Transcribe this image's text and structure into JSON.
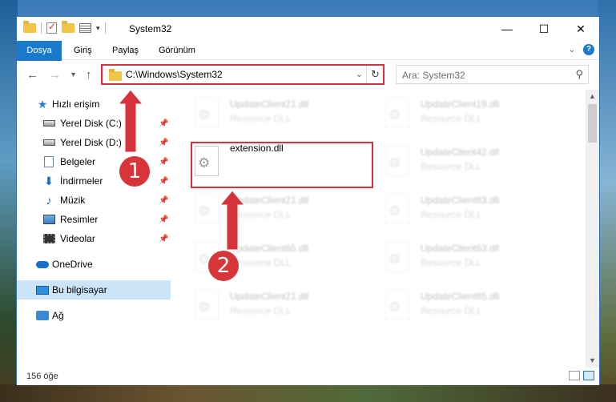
{
  "window": {
    "title": "System32",
    "controls": {
      "minimize": "—",
      "maximize": "☐",
      "close": "✕"
    }
  },
  "ribbon": {
    "tabs": [
      "Dosya",
      "Giriş",
      "Paylaş",
      "Görünüm"
    ]
  },
  "navigation": {
    "back": "←",
    "forward": "→",
    "recent": "▾",
    "up": "↑",
    "address": "C:\\Windows\\System32",
    "search_placeholder": "Ara: System32"
  },
  "sidebar": {
    "items": [
      {
        "label": "Hızlı erişim",
        "icon": "star-icon",
        "pinned": false
      },
      {
        "label": "Yerel Disk (C:)",
        "icon": "drive-icon",
        "pinned": true
      },
      {
        "label": "Yerel Disk (D:)",
        "icon": "drive-icon",
        "pinned": true
      },
      {
        "label": "Belgeler",
        "icon": "document-icon",
        "pinned": true
      },
      {
        "label": "İndirmeler",
        "icon": "download-icon",
        "pinned": true
      },
      {
        "label": "Müzik",
        "icon": "music-icon",
        "pinned": true
      },
      {
        "label": "Resimler",
        "icon": "pictures-icon",
        "pinned": true
      },
      {
        "label": "Videolar",
        "icon": "videos-icon",
        "pinned": true
      },
      {
        "label": "OneDrive",
        "icon": "cloud-icon",
        "pinned": false
      },
      {
        "label": "Bu bilgisayar",
        "icon": "computer-icon",
        "pinned": false,
        "selected": true
      },
      {
        "label": "Ağ",
        "icon": "network-icon",
        "pinned": false
      }
    ]
  },
  "files": [
    {
      "name": "UpdateClient21.dll",
      "type": "Resource DLL",
      "highlighted": false
    },
    {
      "name": "UpdateClient19.dll",
      "type": "Resource DLL",
      "highlighted": false
    },
    {
      "name": "extension.dll",
      "type": "",
      "highlighted": true
    },
    {
      "name": "UpdateClient42.dll",
      "type": "Resource DLL",
      "highlighted": false
    },
    {
      "name": "UpdateClient21.dll",
      "type": "Resource DLL",
      "highlighted": false
    },
    {
      "name": "UpdateClient63.dll",
      "type": "Resource DLL",
      "highlighted": false
    },
    {
      "name": "UpdateClient65.dll",
      "type": "Resource DLL",
      "highlighted": false
    },
    {
      "name": "UpdateClient63.dll",
      "type": "Resource DLL",
      "highlighted": false
    },
    {
      "name": "UpdateClient21.dll",
      "type": "Resource DLL",
      "highlighted": false
    },
    {
      "name": "UpdateClient65.dll",
      "type": "Resource DLL",
      "highlighted": false
    }
  ],
  "status": {
    "item_count": "156 öğe"
  },
  "annotations": {
    "step1": "1",
    "step2": "2",
    "color": "#d6343a"
  }
}
